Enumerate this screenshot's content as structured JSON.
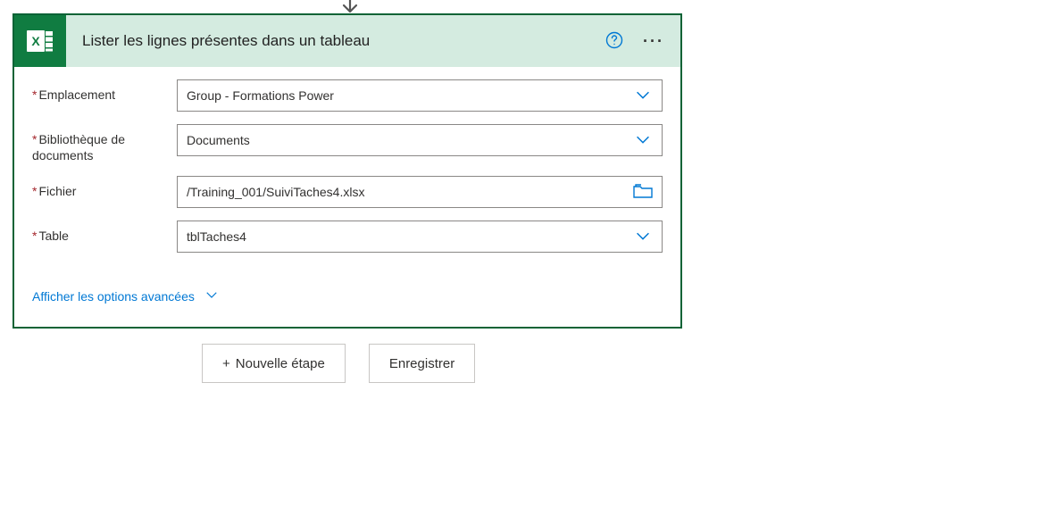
{
  "card": {
    "title": "Lister les lignes présentes dans un tableau"
  },
  "fields": {
    "emplacement": {
      "label": "Emplacement",
      "value": "Group - Formations Power"
    },
    "bibliotheque": {
      "label": "Bibliothèque de documents",
      "value": "Documents"
    },
    "fichier": {
      "label": "Fichier",
      "value": "/Training_001/SuiviTaches4.xlsx"
    },
    "table": {
      "label": "Table",
      "value": "tblTaches4"
    }
  },
  "advanced": "Afficher les options avancées",
  "footer": {
    "newStep": "Nouvelle étape",
    "save": "Enregistrer"
  }
}
